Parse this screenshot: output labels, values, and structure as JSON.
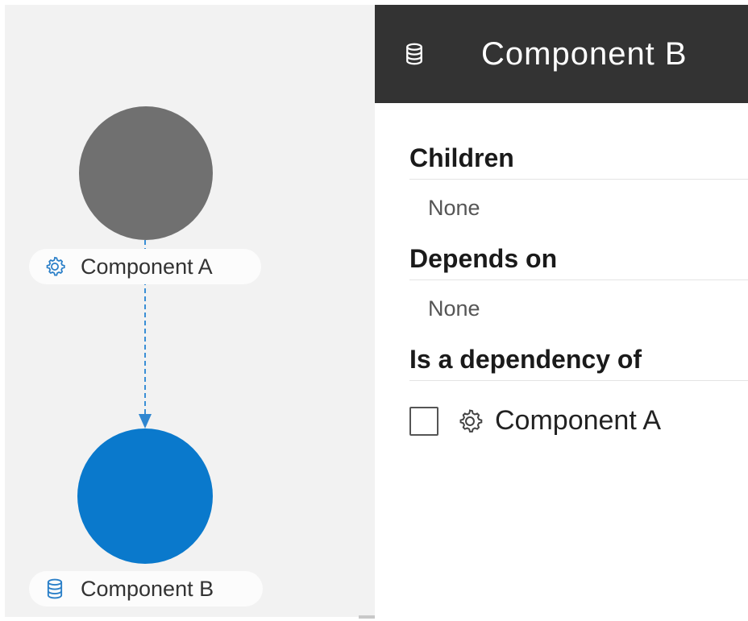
{
  "graph": {
    "nodes": [
      {
        "label": "Component A",
        "icon": "gear-icon",
        "color": "#707070"
      },
      {
        "label": "Component B",
        "icon": "database-icon",
        "color": "#0a79cc"
      }
    ],
    "edge": {
      "style": "dashed",
      "color": "#3a8fd6"
    }
  },
  "panel": {
    "header": {
      "icon": "database-icon",
      "title": "Component B"
    },
    "sections": {
      "children": {
        "title": "Children",
        "empty_text": "None"
      },
      "depends_on": {
        "title": "Depends on",
        "empty_text": "None"
      },
      "dependency_of": {
        "title": "Is a dependency of",
        "items": [
          {
            "label": "Component A",
            "icon": "gear-icon",
            "checked": false
          }
        ]
      }
    }
  },
  "colors": {
    "header_bg": "#333333",
    "canvas_bg": "#f2f2f2",
    "accent": "#0a79cc"
  }
}
